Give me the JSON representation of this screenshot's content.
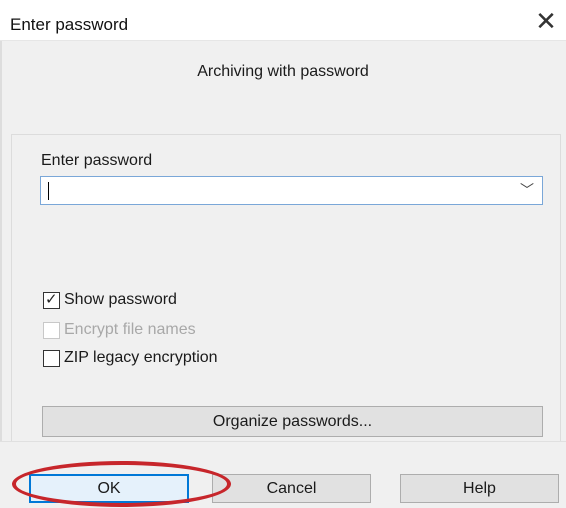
{
  "window": {
    "title": "Enter password",
    "close_glyph": "✕"
  },
  "dialog": {
    "subtitle": "Archiving with password",
    "password_label": "Enter password",
    "password_value": "",
    "dropdown_glyph": "﹀"
  },
  "options": {
    "show_password": {
      "label": "Show password",
      "checked": true,
      "enabled": true
    },
    "encrypt_file_names": {
      "label": "Encrypt file names",
      "checked": false,
      "enabled": false
    },
    "zip_legacy_encryption": {
      "label": "ZIP legacy encryption",
      "checked": false,
      "enabled": true
    }
  },
  "buttons": {
    "organize": "Organize passwords...",
    "ok": "OK",
    "cancel": "Cancel",
    "help": "Help"
  },
  "icons": {
    "close": "close-icon",
    "dropdown": "chevron-down-icon",
    "checkmark": "checkmark-icon"
  },
  "colors": {
    "highlight_ring": "#c7262b",
    "default_button_border": "#0078d7",
    "dialog_background": "#f0f0f0"
  }
}
